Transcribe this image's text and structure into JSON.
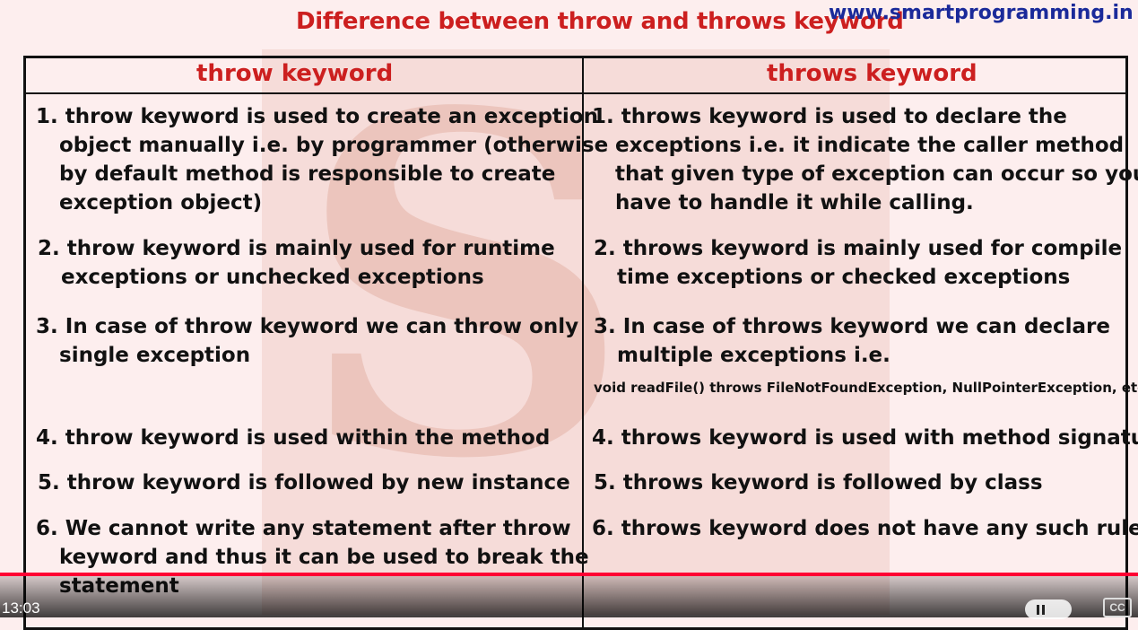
{
  "slide": {
    "title": "Difference between throw and throws keyword",
    "website": "www.smartprogramming.in",
    "left_header": "throw keyword",
    "right_header": "throws keyword",
    "left_items": [
      {
        "num": "1.",
        "lines": [
          "throw keyword is used to create an exception",
          "object manually i.e. by programmer (otherwise",
          "by default method is responsible to create",
          "exception object)"
        ]
      },
      {
        "num": "2.",
        "lines": [
          "throw keyword is mainly used for runtime",
          "exceptions or unchecked exceptions"
        ]
      },
      {
        "num": "3.",
        "lines": [
          "In case of throw keyword we can throw only",
          "single exception"
        ]
      },
      {
        "num": "4.",
        "lines": [
          "throw keyword is used within the method"
        ]
      },
      {
        "num": "5.",
        "lines": [
          "throw keyword is followed by new instance"
        ]
      },
      {
        "num": "6.",
        "lines": [
          "We cannot write any statement after throw",
          "keyword and thus it can be used to break the",
          "statement"
        ]
      }
    ],
    "right_items": [
      {
        "num": "1.",
        "lines": [
          "throws keyword is used to declare the",
          "exceptions i.e. it indicate the caller method",
          "that given type of exception can occur so you",
          "have to handle it while calling."
        ]
      },
      {
        "num": "2.",
        "lines": [
          "throws keyword is mainly used for compile",
          "time exceptions or checked exceptions"
        ]
      },
      {
        "num": "3.",
        "lines": [
          "In case of throws keyword we can declare",
          "multiple exceptions i.e."
        ]
      },
      {
        "num": "4.",
        "lines": [
          "throws keyword is used with method signature"
        ]
      },
      {
        "num": "5.",
        "lines": [
          "throws keyword is followed by class"
        ]
      },
      {
        "num": "6.",
        "lines": [
          "throws keyword does not have any such rule"
        ]
      }
    ],
    "signature_example": "void readFile() throws FileNotFoundException, NullPointerException, etc."
  },
  "player": {
    "time": "13:03",
    "progress": 1.0,
    "cc_label": "CC",
    "progress_color": "#ff0033"
  }
}
